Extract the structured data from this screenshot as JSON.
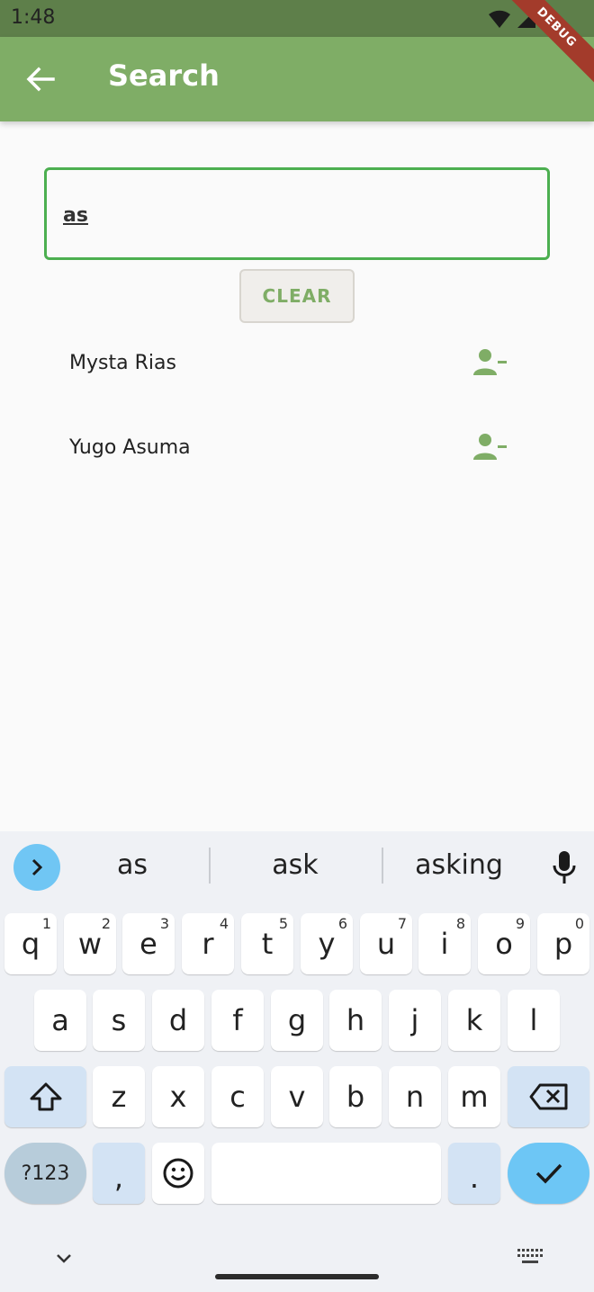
{
  "status_bar": {
    "time": "1:48",
    "debug_label": "DEBUG"
  },
  "app_bar": {
    "title": "Search",
    "back_icon": "arrow-left-icon"
  },
  "search": {
    "value": "as",
    "placeholder": ""
  },
  "clear_button": {
    "label": "CLEAR"
  },
  "results": [
    {
      "name": "Mysta Rias",
      "action_icon": "person-remove-icon"
    },
    {
      "name": "Yugo Asuma",
      "action_icon": "person-remove-icon"
    }
  ],
  "keyboard": {
    "suggestions": [
      "as",
      "ask",
      "asking"
    ],
    "row1": [
      {
        "key": "q",
        "hint": "1"
      },
      {
        "key": "w",
        "hint": "2"
      },
      {
        "key": "e",
        "hint": "3"
      },
      {
        "key": "r",
        "hint": "4"
      },
      {
        "key": "t",
        "hint": "5"
      },
      {
        "key": "y",
        "hint": "6"
      },
      {
        "key": "u",
        "hint": "7"
      },
      {
        "key": "i",
        "hint": "8"
      },
      {
        "key": "o",
        "hint": "9"
      },
      {
        "key": "p",
        "hint": "0"
      }
    ],
    "row2": [
      "a",
      "s",
      "d",
      "f",
      "g",
      "h",
      "j",
      "k",
      "l"
    ],
    "row3": [
      "z",
      "x",
      "c",
      "v",
      "b",
      "n",
      "m"
    ],
    "symbols_label": "?123",
    "comma_label": ",",
    "period_label": "."
  },
  "colors": {
    "primary": "#7fad66",
    "status_bar": "#5e7f4a",
    "accent_blue": "#6dc6f5",
    "field_border": "#4caf50"
  }
}
